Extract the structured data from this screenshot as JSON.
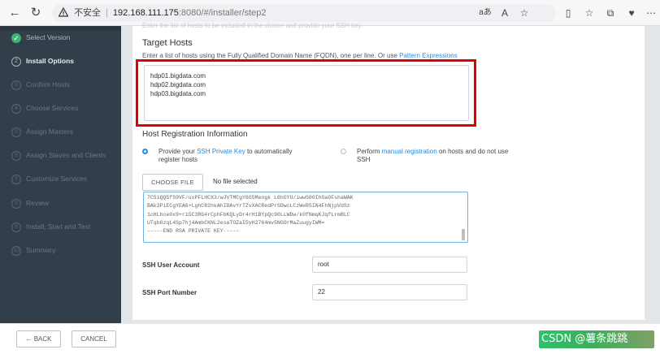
{
  "browser": {
    "insecure_label": "不安全",
    "url_host": "192.168.111.175",
    "url_path": ":8080/#/installer/step2",
    "tab_reader_label": "aあ",
    "tab_text_label": "A"
  },
  "sidebar": {
    "steps": [
      {
        "num": "✓",
        "label": "Select Version",
        "state": "done"
      },
      {
        "num": "2",
        "label": "Install Options",
        "state": "current"
      },
      {
        "num": "3",
        "label": "Confirm Hosts",
        "state": "pending"
      },
      {
        "num": "4",
        "label": "Choose Services",
        "state": "pending"
      },
      {
        "num": "5",
        "label": "Assign Masters",
        "state": "pending"
      },
      {
        "num": "6",
        "label": "Assign Slaves and Clients",
        "state": "pending"
      },
      {
        "num": "7",
        "label": "Customize Services",
        "state": "pending"
      },
      {
        "num": "8",
        "label": "Review",
        "state": "pending"
      },
      {
        "num": "9",
        "label": "Install, Start and Test",
        "state": "pending"
      },
      {
        "num": "10",
        "label": "Summary",
        "state": "pending"
      }
    ]
  },
  "main": {
    "clipped_text": "Enter the list of hosts to be included in the cluster and provide your SSH key.",
    "target_hosts": {
      "title": "Target Hosts",
      "description": "Enter a list of hosts using the Fully Qualified Domain Name (FQDN), one per line. Or use ",
      "pattern_link": "Pattern Expressions",
      "hosts_value": "hdp01.bigdata.com\nhdp02.bigdata.com\nhdp03.bigdata.com"
    },
    "registration": {
      "title": "Host Registration Information",
      "option1_pre": "Provide your ",
      "option1_link": "SSH Private Key",
      "option1_post": " to automatically register hosts",
      "option2_pre": "Perform ",
      "option2_link": "manual registration",
      "option2_post": " on hosts and do not use SSH",
      "choose_file_label": "CHOOSE FILE",
      "no_file_label": "No file selected",
      "key_lines": [
        "7C51QQ5fS9VF/uxPFLHCX3/wJVTMCgY6G5Mengk L0hGYU/iwwS00IhOaOFshaWAK",
        "BAk3PiECgYEA6+LghC82hkAhIDAvYrTZvXACRedPrSDwcLCzWeRSIN4FhNjpVdSz",
        "1cHLhce0x9+ri5C3RG4rCphFbKQLyDr4rH1BYpQc90LLWDw/k0fNmqKJqfLrmBLC",
        "UTqb6zqL4Sp7hj4AmbCKNL2esaTOZaI5yH2764mv5NGOrMaZuugyIWM=",
        "-----END RSA PRIVATE KEY-----"
      ],
      "ssh_user_label": "SSH User Account",
      "ssh_user_value": "root",
      "ssh_port_label": "SSH Port Number",
      "ssh_port_value": "22"
    }
  },
  "footer": {
    "back_label": "← BACK",
    "cancel_label": "CANCEL"
  },
  "watermark": "CSDN @薯条跳跳"
}
